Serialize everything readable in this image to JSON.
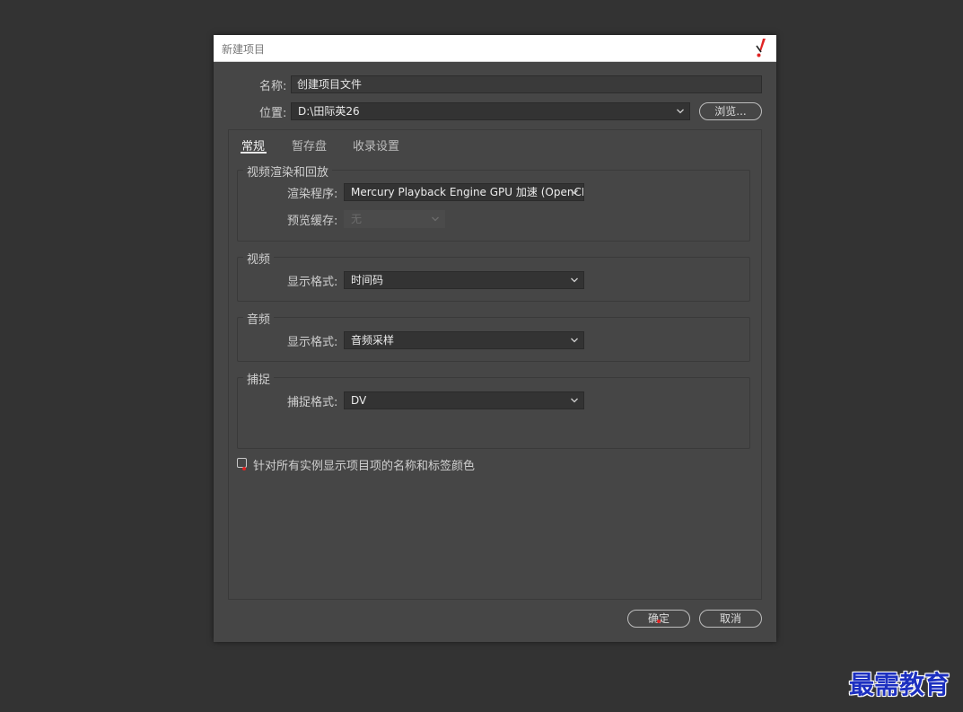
{
  "dialog": {
    "title": "新建项目",
    "name_label": "名称:",
    "name_value": "创建项目文件",
    "location_label": "位置:",
    "location_value": "D:\\田际英26",
    "browse_label": "浏览...",
    "ok_label": "确定",
    "cancel_label": "取消"
  },
  "tabs": [
    {
      "label": "常规"
    },
    {
      "label": "暂存盘"
    },
    {
      "label": "收录设置"
    }
  ],
  "groups": {
    "render": {
      "title": "视频渲染和回放",
      "renderer_label": "渲染程序:",
      "renderer_value": "Mercury Playback Engine GPU 加速 (OpenCL)",
      "preview_cache_label": "预览缓存:",
      "preview_cache_value": "无"
    },
    "video": {
      "title": "视频",
      "display_format_label": "显示格式:",
      "display_format_value": "时间码"
    },
    "audio": {
      "title": "音频",
      "display_format_label": "显示格式:",
      "display_format_value": "音频采样"
    },
    "capture": {
      "title": "捕捉",
      "capture_format_label": "捕捉格式:",
      "capture_format_value": "DV"
    }
  },
  "checkbox": {
    "label": "针对所有实例显示项目项的名称和标签颜色",
    "checked": false
  },
  "watermark": {
    "text": "最需教育"
  },
  "colors": {
    "background": "#333333",
    "dialog": "#464646",
    "titlebar": "#ffffff",
    "accent_red": "#e02424",
    "watermark": "#1c2fc0"
  },
  "icons": {
    "close": "red-exclamation-close-icon",
    "dropdown": "chevron-down-icon"
  }
}
